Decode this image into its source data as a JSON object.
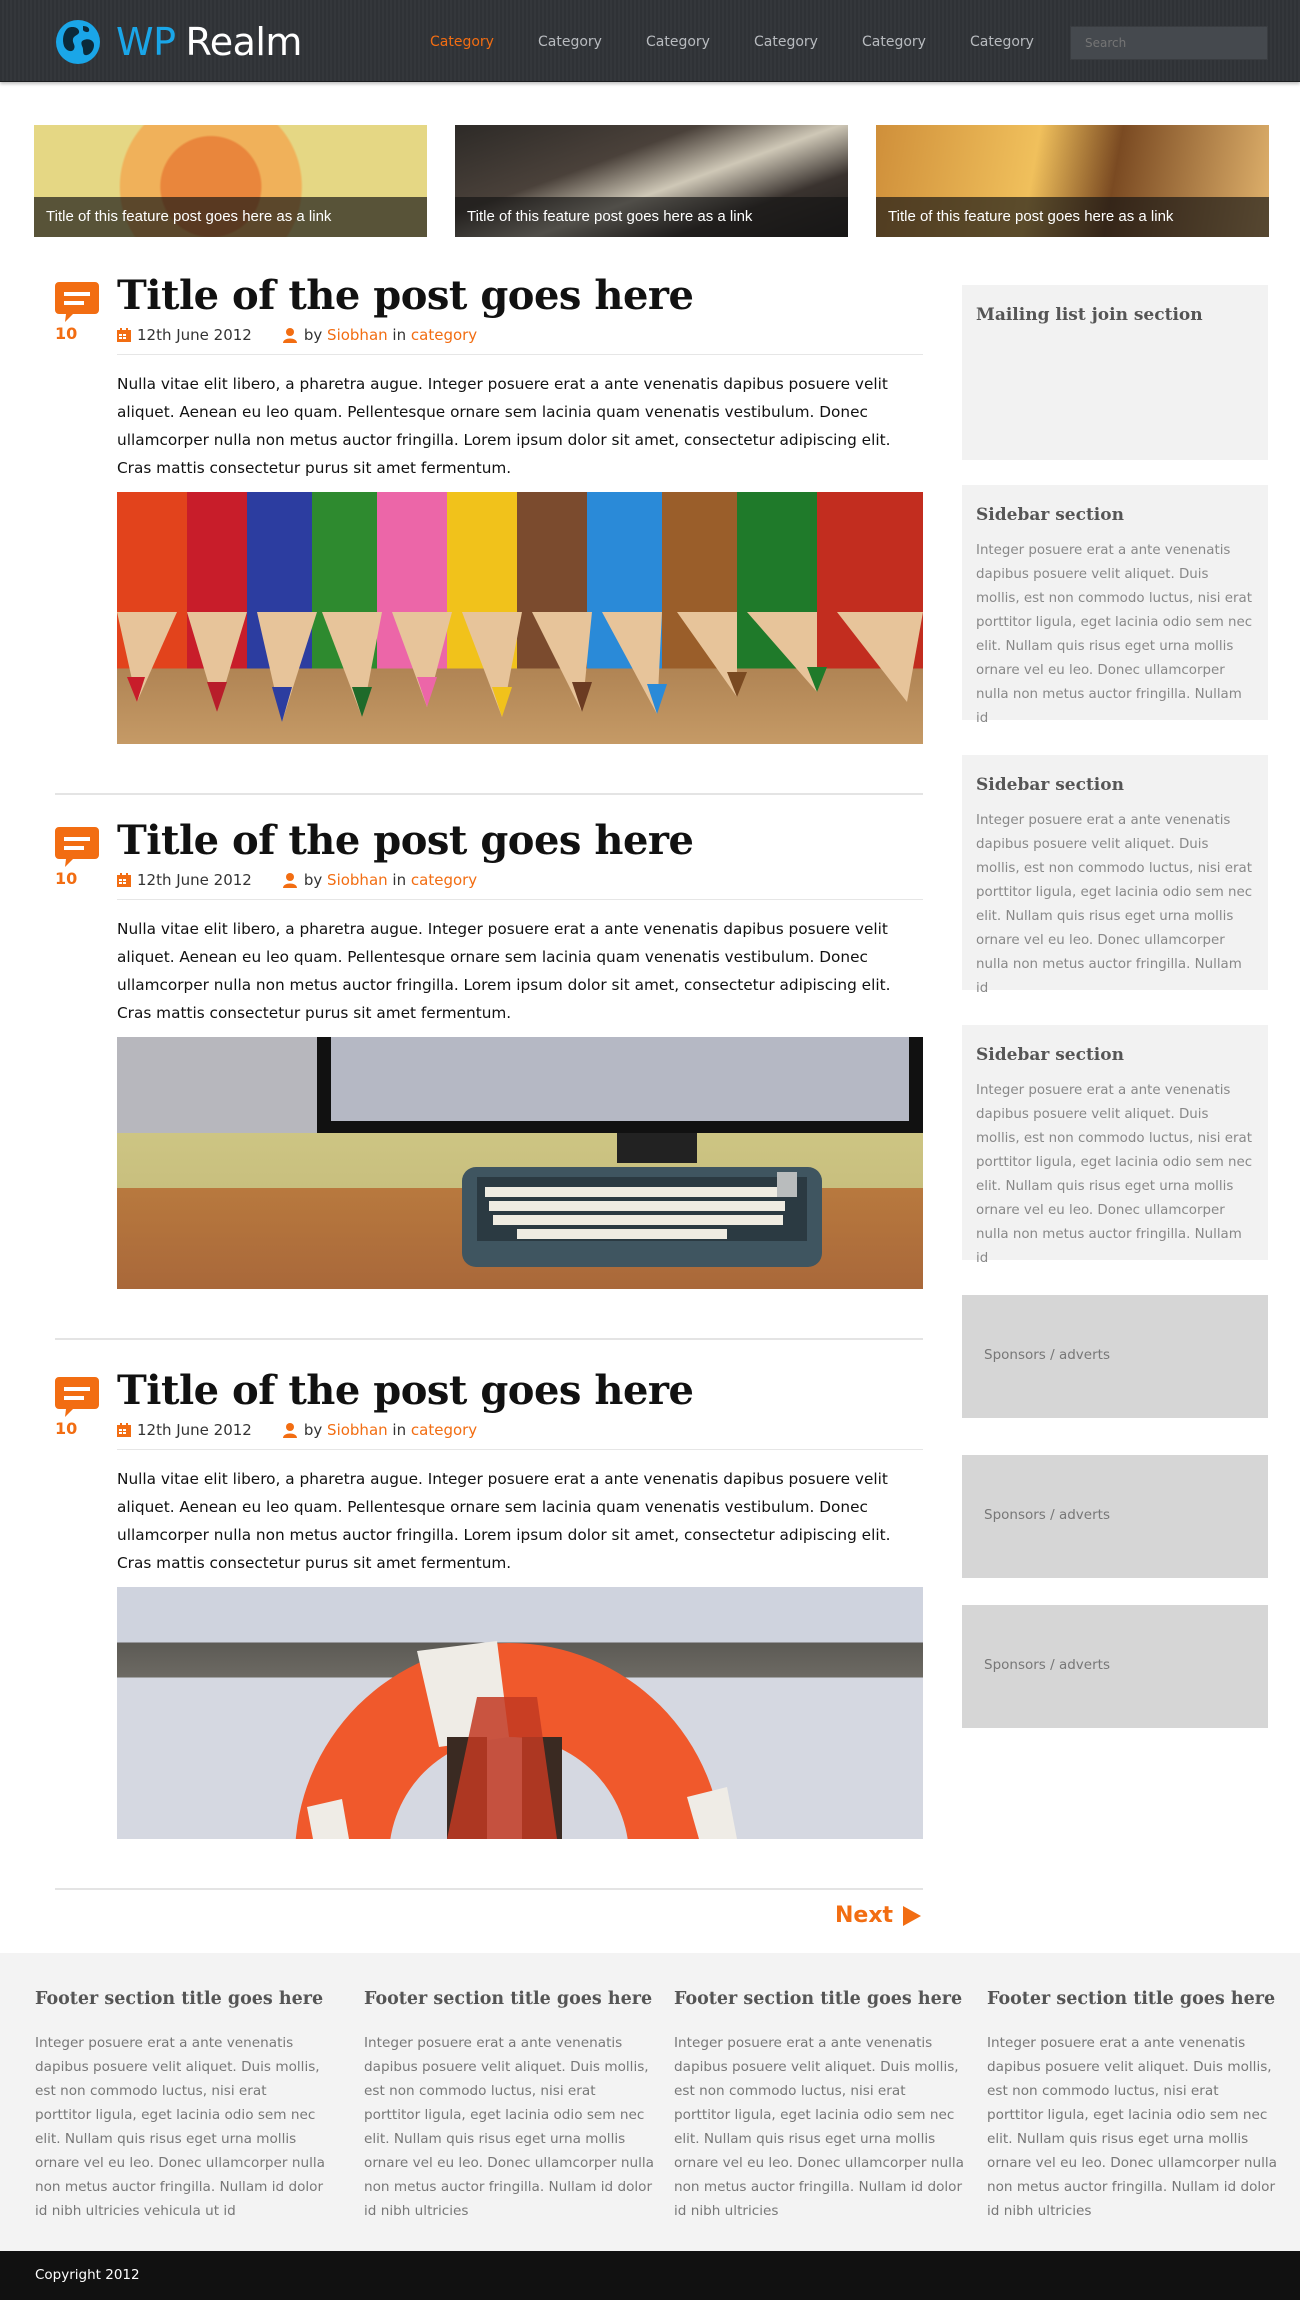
{
  "header": {
    "logo_wp": "WP",
    "logo_realm": "Realm",
    "nav": [
      "Category",
      "Category",
      "Category",
      "Category",
      "Category",
      "Category"
    ],
    "search_placeholder": "Search"
  },
  "featured": [
    {
      "caption": "Title of this feature post goes here as a link"
    },
    {
      "caption": "Title of this feature post goes here as a link"
    },
    {
      "caption": "Title of this feature post goes here as a link"
    }
  ],
  "posts": [
    {
      "comments": "10",
      "title": "Title of the post goes here",
      "date": "12th June 2012",
      "by": "by",
      "author": "Siobhan",
      "in": "in",
      "category": "category",
      "excerpt": "Nulla vitae elit libero, a pharetra augue. Integer posuere erat a ante venenatis dapibus posuere velit aliquet. Aenean eu leo quam. Pellentesque ornare sem lacinia quam venenatis vestibulum. Donec ullamcorper nulla non metus auctor fringilla. Lorem ipsum dolor sit amet, consectetur adipiscing elit. Cras mattis consectetur purus sit amet fermentum."
    },
    {
      "comments": "10",
      "title": "Title of the post goes here",
      "date": "12th June 2012",
      "by": "by",
      "author": "Siobhan",
      "in": "in",
      "category": "category",
      "excerpt": "Nulla vitae elit libero, a pharetra augue. Integer posuere erat a ante venenatis dapibus posuere velit aliquet. Aenean eu leo quam. Pellentesque ornare sem lacinia quam venenatis vestibulum. Donec ullamcorper nulla non metus auctor fringilla. Lorem ipsum dolor sit amet, consectetur adipiscing elit. Cras mattis consectetur purus sit amet fermentum."
    },
    {
      "comments": "10",
      "title": "Title of the post goes here",
      "date": "12th June 2012",
      "by": "by",
      "author": "Siobhan",
      "in": "in",
      "category": "category",
      "excerpt": "Nulla vitae elit libero, a pharetra augue. Integer posuere erat a ante venenatis dapibus posuere velit aliquet. Aenean eu leo quam. Pellentesque ornare sem lacinia quam venenatis vestibulum. Donec ullamcorper nulla non metus auctor fringilla. Lorem ipsum dolor sit amet, consectetur adipiscing elit. Cras mattis consectetur purus sit amet fermentum."
    }
  ],
  "pagination": {
    "next": "Next"
  },
  "sidebar": {
    "mailing_title": "Mailing list join section",
    "sections": [
      {
        "title": "Sidebar section",
        "text": "Integer posuere erat a ante venenatis dapibus posuere velit aliquet. Duis mollis, est non commodo luctus, nisi erat porttitor ligula, eget lacinia odio sem nec elit. Nullam quis risus eget urna mollis ornare vel eu leo. Donec ullamcorper nulla non metus auctor fringilla. Nullam id"
      },
      {
        "title": "Sidebar section",
        "text": "Integer posuere erat a ante venenatis dapibus posuere velit aliquet. Duis mollis, est non commodo luctus, nisi erat porttitor ligula, eget lacinia odio sem nec elit. Nullam quis risus eget urna mollis ornare vel eu leo. Donec ullamcorper nulla non metus auctor fringilla. Nullam id"
      },
      {
        "title": "Sidebar section",
        "text": "Integer posuere erat a ante venenatis dapibus posuere velit aliquet. Duis mollis, est non commodo luctus, nisi erat porttitor ligula, eget lacinia odio sem nec elit. Nullam quis risus eget urna mollis ornare vel eu leo. Donec ullamcorper nulla non metus auctor fringilla. Nullam id"
      }
    ],
    "ads": [
      "Sponsors / adverts",
      "Sponsors / adverts",
      "Sponsors / adverts"
    ]
  },
  "footer": {
    "columns": [
      {
        "title": "Footer section title goes here",
        "text": "Integer posuere erat a ante venenatis dapibus posuere velit aliquet. Duis mollis, est non commodo luctus, nisi erat porttitor ligula, eget lacinia odio sem nec elit. Nullam quis risus eget urna mollis ornare vel eu leo. Donec ullamcorper nulla non metus auctor fringilla. Nullam id dolor id nibh ultricies vehicula ut id"
      },
      {
        "title": "Footer section title goes here",
        "text": "Integer posuere erat a ante venenatis dapibus posuere velit aliquet. Duis mollis, est non commodo luctus, nisi erat porttitor ligula, eget lacinia odio sem nec elit. Nullam quis risus eget urna mollis ornare vel eu leo. Donec ullamcorper nulla non metus auctor fringilla. Nullam id dolor id nibh ultricies"
      },
      {
        "title": "Footer section title goes here",
        "text": "Integer posuere erat a ante venenatis dapibus posuere velit aliquet. Duis mollis, est non commodo luctus, nisi erat porttitor ligula, eget lacinia odio sem nec elit. Nullam quis risus eget urna mollis ornare vel eu leo. Donec ullamcorper nulla non metus auctor fringilla. Nullam id dolor id nibh ultricies"
      },
      {
        "title": "Footer section title goes here",
        "text": "Integer posuere erat a ante venenatis dapibus posuere velit aliquet. Duis mollis, est non commodo luctus, nisi erat porttitor ligula, eget lacinia odio sem nec elit. Nullam quis risus eget urna mollis ornare vel eu leo. Donec ullamcorper nulla non metus auctor fringilla. Nullam id dolor id nibh ultricies"
      }
    ],
    "copyright": "Copyright 2012"
  },
  "icons": {
    "logo": "globe-icon",
    "comments": "speech-bubble-icon",
    "date": "calendar-icon",
    "author": "user-icon",
    "next": "play-arrow-icon"
  },
  "colors": {
    "accent": "#f26d12",
    "logo_blue": "#1aa6e8",
    "header_bg": "#323539",
    "sidebar_bg": "#f2f2f2",
    "ad_bg": "#d6d6d6",
    "footer_bg": "#f3f3f3",
    "copyright_bg": "#111111"
  }
}
